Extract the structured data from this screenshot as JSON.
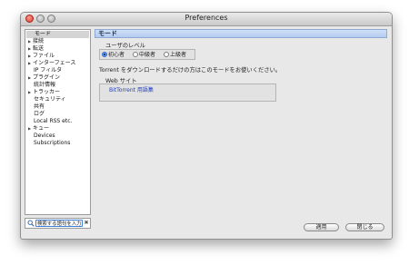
{
  "window": {
    "title": "Preferences"
  },
  "sidebar": {
    "items": [
      {
        "label": "モード",
        "expandable": false,
        "indent": 1,
        "selected": true
      },
      {
        "label": "接続",
        "expandable": true,
        "indent": 0
      },
      {
        "label": "転送",
        "expandable": true,
        "indent": 0
      },
      {
        "label": "ファイル",
        "expandable": true,
        "indent": 0
      },
      {
        "label": "インターフェース",
        "expandable": true,
        "indent": 0
      },
      {
        "label": "IP フィルタ",
        "expandable": false,
        "indent": 1
      },
      {
        "label": "プラグイン",
        "expandable": true,
        "indent": 0
      },
      {
        "label": "統計情報",
        "expandable": false,
        "indent": 1
      },
      {
        "label": "トラッカー",
        "expandable": true,
        "indent": 0
      },
      {
        "label": "セキュリティ",
        "expandable": false,
        "indent": 1
      },
      {
        "label": "共有",
        "expandable": false,
        "indent": 1
      },
      {
        "label": "ログ",
        "expandable": false,
        "indent": 1
      },
      {
        "label": "Local RSS etc.",
        "expandable": false,
        "indent": 1
      },
      {
        "label": "キュー",
        "expandable": true,
        "indent": 0
      },
      {
        "label": "Devices",
        "expandable": false,
        "indent": 1
      },
      {
        "label": "Subscriptions",
        "expandable": false,
        "indent": 1
      }
    ]
  },
  "search": {
    "placeholder": "検索する語句を入力",
    "value": "検索する語句を入力"
  },
  "main": {
    "header": "モード",
    "user_level_label": "ユーザのレベル",
    "levels": [
      {
        "label": "初心者",
        "checked": true
      },
      {
        "label": "中級者",
        "checked": false
      },
      {
        "label": "上級者",
        "checked": false
      }
    ],
    "description": "Torrent をダウンロードするだけの方はこのモードをお使いください。",
    "web_label": "Web サイト",
    "web_link": "BitTorrent 用語集"
  },
  "buttons": {
    "apply": "適用",
    "close": "閉じる"
  }
}
